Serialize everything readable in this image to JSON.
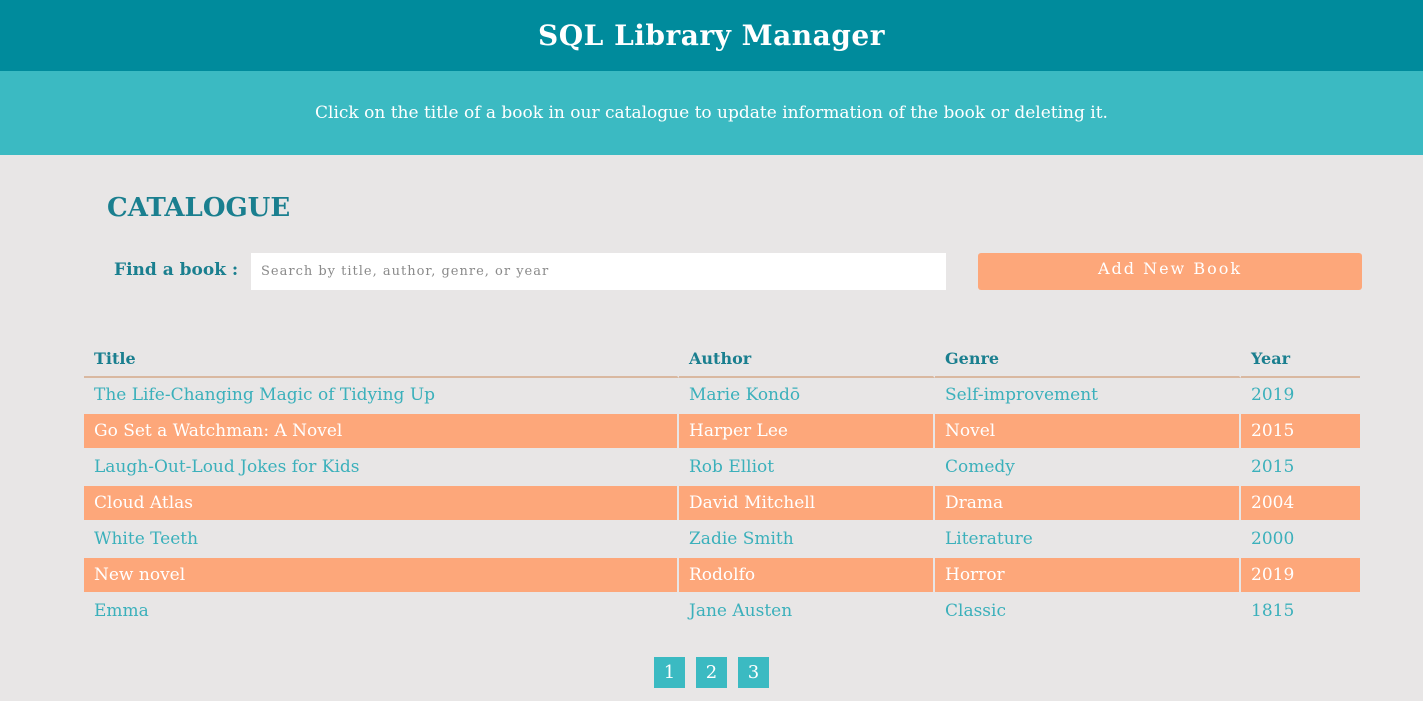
{
  "header": {
    "title": "SQL Library Manager"
  },
  "banner": {
    "text": "Click on the title of a book in our catalogue to update information of the book or deleting it."
  },
  "catalogue": {
    "heading": "CATALOGUE",
    "search": {
      "label": "Find a book :",
      "placeholder": "Search by title, author, genre, or year",
      "value": ""
    },
    "add_button_label": "Add New Book",
    "columns": [
      "Title",
      "Author",
      "Genre",
      "Year"
    ],
    "rows": [
      {
        "title": "The Life-Changing Magic of Tidying Up",
        "author": "Marie Kondō",
        "genre": "Self-improvement",
        "year": "2019"
      },
      {
        "title": "Go Set a Watchman: A Novel",
        "author": "Harper Lee",
        "genre": "Novel",
        "year": "2015"
      },
      {
        "title": "Laugh-Out-Loud Jokes for Kids",
        "author": "Rob Elliot",
        "genre": "Comedy",
        "year": "2015"
      },
      {
        "title": "Cloud Atlas",
        "author": "David Mitchell",
        "genre": "Drama",
        "year": "2004"
      },
      {
        "title": "White Teeth",
        "author": "Zadie Smith",
        "genre": "Literature",
        "year": "2000"
      },
      {
        "title": "New novel",
        "author": "Rodolfo",
        "genre": "Horror",
        "year": "2019"
      },
      {
        "title": "Emma",
        "author": "Jane Austen",
        "genre": "Classic",
        "year": "1815"
      }
    ],
    "pagination": [
      "1",
      "2",
      "3"
    ]
  },
  "colors": {
    "header_bg": "#008b9c",
    "banner_bg": "#3bbac2",
    "accent": "#fda77a",
    "text_teal": "#1a7f8f",
    "page_bg": "#e8e6e6"
  }
}
